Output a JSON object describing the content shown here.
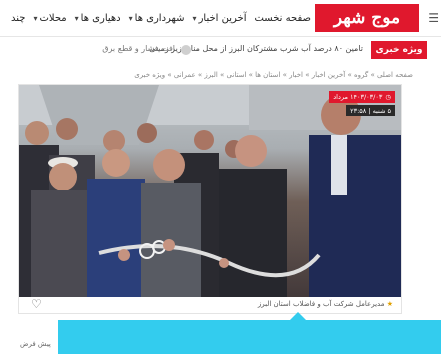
{
  "header": {
    "logo_text": "موج شهر",
    "nav": [
      {
        "label": "صفحه نخست"
      },
      {
        "label": "آخرین اخبار"
      },
      {
        "label": "شهرداری ها"
      },
      {
        "label": "دهیاری ها"
      },
      {
        "label": "محلات"
      },
      {
        "label": "چند"
      }
    ]
  },
  "breaking": {
    "label": "ویژه خبری",
    "headline": "تامین ۸۰ درصد آب شرب مشترکان البرز از محل منابع زیر زمینی",
    "headline2": "افت فشار و قطع برق"
  },
  "breadcrumb": "صفحه اصلی » گروه » آخرین اخبار » اخبار » استان ها » استانی » البرز » عمرانی » ویژه خبری",
  "article": {
    "date_badge": "۱۴۰۳/۰۳/۰۳ مرداد",
    "time_badge": "۵ شنبه | ۲۳:۵۸",
    "tags": "مدیرعامل شرکت آب و فاضلاب استان البرز",
    "share_label": "پیش فرض"
  },
  "colors": {
    "brand": "#e0182d",
    "overlay": "#33ccee"
  }
}
